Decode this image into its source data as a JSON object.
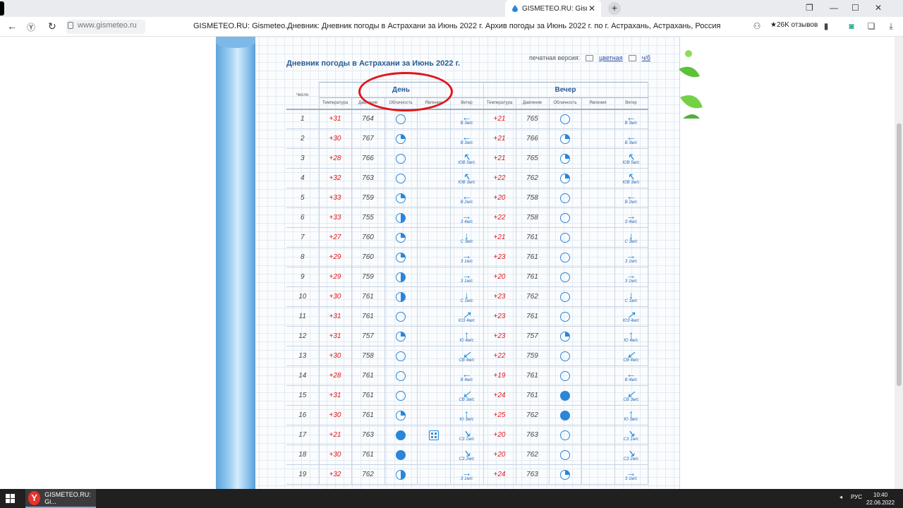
{
  "browser": {
    "tab_title": "GISMETEO.RU: Gismeteo.Дневник",
    "url": "www.gismeteo.ru",
    "page_title": "GISMETEO.RU: Gismeteo.Дневник: Дневник погоды в Астрахани за Июнь 2022 г. Архив погоды за Июнь 2022 г. по г. Астрахань, Астрахань, Россия",
    "reviews": "★26K отзывов",
    "new_tab": "+",
    "close_tab": "✕"
  },
  "page": {
    "title": "Дневник погоды в Астрахани за Июнь 2022 г.",
    "print_label": "печатная версия:",
    "print_color": "цветная",
    "print_bw": "ч/б"
  },
  "table": {
    "col_num": "Число",
    "group_day": "День",
    "group_evening": "Вечер",
    "sub": {
      "temp": "Температура",
      "pres": "Давление",
      "cloud": "Облачность",
      "phen": "Явления",
      "wind": "Ветер"
    },
    "rows": [
      {
        "d": "1",
        "dt": "+31",
        "dp": "764",
        "dc": "clear",
        "dph": "",
        "dwa": "←",
        "dw": "В 3м/с",
        "et": "+21",
        "ep": "765",
        "ec": "clear",
        "ewa": "←",
        "ew": "В 3м/с"
      },
      {
        "d": "2",
        "dt": "+30",
        "dp": "767",
        "dc": "partly",
        "dph": "",
        "dwa": "←",
        "dw": "В 3м/с",
        "et": "+21",
        "ep": "766",
        "ec": "partly",
        "ewa": "←",
        "ew": "В 3м/с"
      },
      {
        "d": "3",
        "dt": "+28",
        "dp": "766",
        "dc": "clear",
        "dph": "",
        "dwa": "↖",
        "dw": "ЮВ 5м/с",
        "et": "+21",
        "ep": "765",
        "ec": "partly",
        "ewa": "↖",
        "ew": "ЮВ 5м/с"
      },
      {
        "d": "4",
        "dt": "+32",
        "dp": "763",
        "dc": "clear",
        "dph": "",
        "dwa": "↖",
        "dw": "ЮВ 3м/с",
        "et": "+22",
        "ep": "762",
        "ec": "partly",
        "ewa": "↖",
        "ew": "ЮВ 3м/с"
      },
      {
        "d": "5",
        "dt": "+33",
        "dp": "759",
        "dc": "partly",
        "dph": "",
        "dwa": "←",
        "dw": "В 2м/с",
        "et": "+20",
        "ep": "758",
        "ec": "clear",
        "ewa": "←",
        "ew": "В 2м/с"
      },
      {
        "d": "6",
        "dt": "+33",
        "dp": "755",
        "dc": "half",
        "dph": "",
        "dwa": "→",
        "dw": "З 4м/с",
        "et": "+22",
        "ep": "758",
        "ec": "clear",
        "ewa": "→",
        "ew": "З 4м/с"
      },
      {
        "d": "7",
        "dt": "+27",
        "dp": "760",
        "dc": "partly",
        "dph": "",
        "dwa": "↓",
        "dw": "С 3м/с",
        "et": "+21",
        "ep": "761",
        "ec": "clear",
        "ewa": "↓",
        "ew": "С 3м/с"
      },
      {
        "d": "8",
        "dt": "+29",
        "dp": "760",
        "dc": "partly",
        "dph": "",
        "dwa": "→",
        "dw": "З 1м/с",
        "et": "+23",
        "ep": "761",
        "ec": "clear",
        "ewa": "→",
        "ew": "З 1м/с"
      },
      {
        "d": "9",
        "dt": "+29",
        "dp": "759",
        "dc": "half",
        "dph": "",
        "dwa": "→",
        "dw": "З 1м/с",
        "et": "+20",
        "ep": "761",
        "ec": "clear",
        "ewa": "→",
        "ew": "З 1м/с"
      },
      {
        "d": "10",
        "dt": "+30",
        "dp": "761",
        "dc": "half",
        "dph": "",
        "dwa": "↓",
        "dw": "С 1м/с",
        "et": "+23",
        "ep": "762",
        "ec": "clear",
        "ewa": "↓",
        "ew": "С 1м/с"
      },
      {
        "d": "11",
        "dt": "+31",
        "dp": "761",
        "dc": "clear",
        "dph": "",
        "dwa": "↗",
        "dw": "ЮЗ 4м/с",
        "et": "+23",
        "ep": "761",
        "ec": "clear",
        "ewa": "↗",
        "ew": "ЮЗ 4м/с"
      },
      {
        "d": "12",
        "dt": "+31",
        "dp": "757",
        "dc": "partly",
        "dph": "",
        "dwa": "↑",
        "dw": "Ю 4м/с",
        "et": "+23",
        "ep": "757",
        "ec": "partly",
        "ewa": "↑",
        "ew": "Ю 4м/с"
      },
      {
        "d": "13",
        "dt": "+30",
        "dp": "758",
        "dc": "clear",
        "dph": "",
        "dwa": "↙",
        "dw": "СВ 4м/с",
        "et": "+22",
        "ep": "759",
        "ec": "clear",
        "ewa": "↙",
        "ew": "СВ 4м/с"
      },
      {
        "d": "14",
        "dt": "+28",
        "dp": "761",
        "dc": "clear",
        "dph": "",
        "dwa": "←",
        "dw": "В 4м/с",
        "et": "+19",
        "ep": "761",
        "ec": "clear",
        "ewa": "←",
        "ew": "В 4м/с"
      },
      {
        "d": "15",
        "dt": "+31",
        "dp": "761",
        "dc": "clear",
        "dph": "",
        "dwa": "↙",
        "dw": "СВ 3м/с",
        "et": "+24",
        "ep": "761",
        "ec": "overcast",
        "ewa": "↙",
        "ew": "СВ 3м/с"
      },
      {
        "d": "16",
        "dt": "+30",
        "dp": "761",
        "dc": "partly",
        "dph": "",
        "dwa": "↑",
        "dw": "Ю 3м/с",
        "et": "+25",
        "ep": "762",
        "ec": "overcast",
        "ewa": "↑",
        "ew": "Ю 3м/с"
      },
      {
        "d": "17",
        "dt": "+21",
        "dp": "763",
        "dc": "overcast",
        "dph": "dust",
        "dwa": "↘",
        "dw": "СЗ 1м/с",
        "et": "+20",
        "ep": "763",
        "ec": "clear",
        "ewa": "↘",
        "ew": "СЗ 1м/с"
      },
      {
        "d": "18",
        "dt": "+30",
        "dp": "761",
        "dc": "overcast",
        "dph": "",
        "dwa": "↘",
        "dw": "СЗ 2м/с",
        "et": "+20",
        "ep": "762",
        "ec": "clear",
        "ewa": "↘",
        "ew": "СЗ 2м/с"
      },
      {
        "d": "19",
        "dt": "+32",
        "dp": "762",
        "dc": "half",
        "dph": "",
        "dwa": "→",
        "dw": "З 1м/с",
        "et": "+24",
        "ep": "763",
        "ec": "partly",
        "ewa": "→",
        "ew": "З 1м/с"
      }
    ]
  },
  "colors": {
    "temp": "#e01818",
    "accent": "#2a86d8",
    "title": "#2a5d94",
    "highlight": "#e0161b"
  },
  "taskbar": {
    "app_label": "GISMETEO.RU: Gi...",
    "lang": "РУС",
    "time": "10:40",
    "date": "22.06.2022"
  }
}
